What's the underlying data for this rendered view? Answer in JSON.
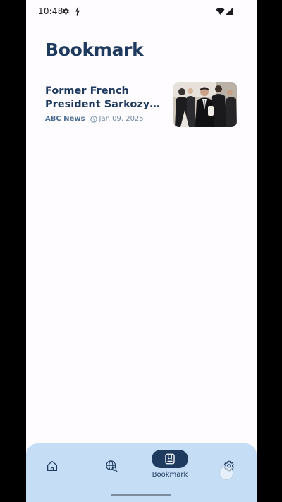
{
  "status_bar": {
    "time": "10:48",
    "icons": [
      "gear-icon",
      "sync-icon",
      "wifi-icon",
      "signal-icon"
    ]
  },
  "page": {
    "title": "Bookmark"
  },
  "articles": [
    {
      "title": "Former French President Sarkozy de…",
      "source": "ABC News",
      "date": "Jan 09, 2025",
      "thumbnail": "news-photo"
    }
  ],
  "bottom_nav": {
    "items": [
      {
        "icon": "home-icon",
        "label": "",
        "active": false
      },
      {
        "icon": "globe-search-icon",
        "label": "",
        "active": false
      },
      {
        "icon": "bookmark-icon",
        "label": "Bookmark",
        "active": true
      },
      {
        "icon": "settings-icon",
        "label": "",
        "active": false
      }
    ]
  },
  "colors": {
    "accent": "#1e3a5f",
    "nav_background": "#c6def5",
    "screen_background": "#fefcff",
    "source_text": "#4a6d92"
  }
}
